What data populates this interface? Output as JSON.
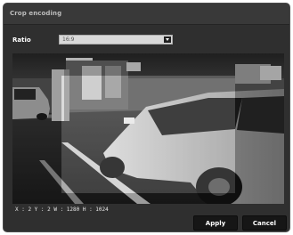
{
  "dialog": {
    "title": "Crop encoding"
  },
  "ratio": {
    "label": "Ratio",
    "selected": "16:9"
  },
  "crop": {
    "readout": "X : 2 Y : 2 W : 1280 H : 1024"
  },
  "buttons": {
    "apply": "Apply",
    "cancel": "Cancel"
  },
  "preview": {
    "description_icon": "camera-preview-image"
  }
}
